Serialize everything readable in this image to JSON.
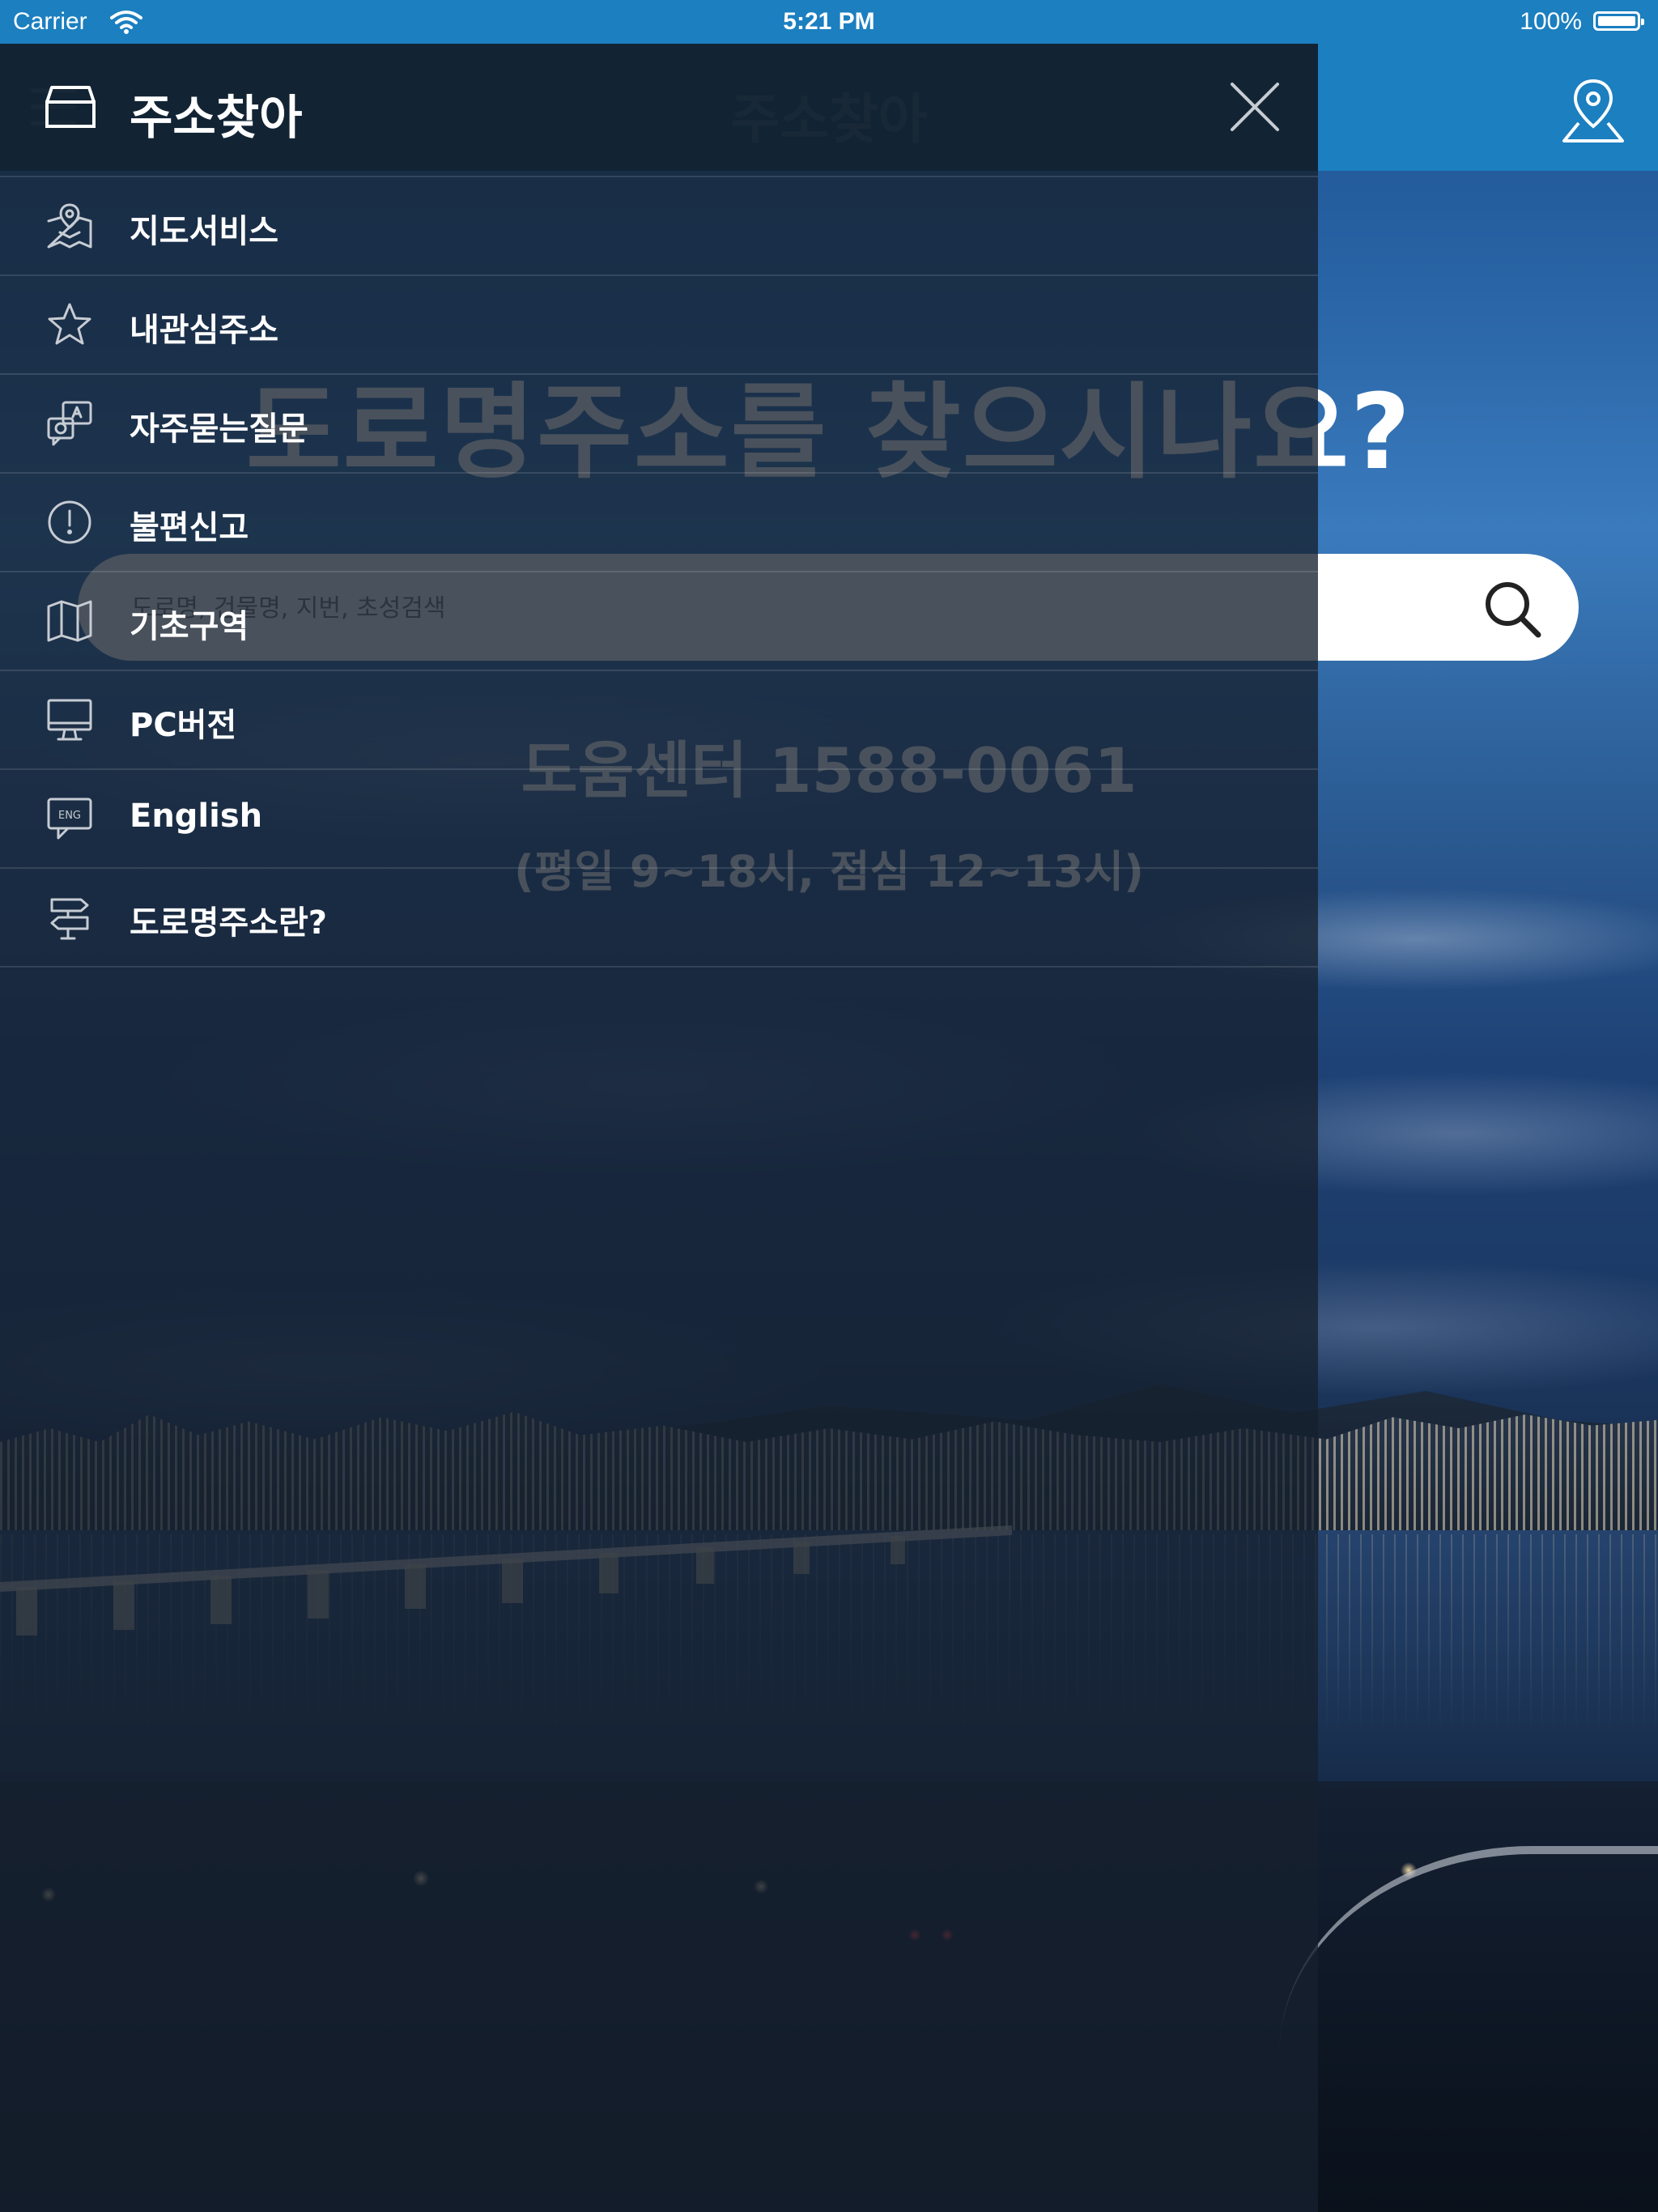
{
  "status_bar": {
    "carrier": "Carrier",
    "time": "5:21 PM",
    "battery": "100%"
  },
  "app_bar": {
    "title": "주소찾아"
  },
  "hero": {
    "question": "도로명주소를 찾으시나요?",
    "search_placeholder": "도로명, 건물명, 지번, 초성검색",
    "help_center": "도움센터 1588-0061",
    "hours": "(평일 9~18시, 점심 12~13시)"
  },
  "drawer": {
    "title": "주소찾아",
    "items": [
      {
        "label": "지도서비스",
        "icon": "map-pin-icon"
      },
      {
        "label": "내관심주소",
        "icon": "star-icon"
      },
      {
        "label": "자주묻는질문",
        "icon": "qa-chat-icon"
      },
      {
        "label": "불편신고",
        "icon": "exclamation-circle-icon"
      },
      {
        "label": "기초구역",
        "icon": "folded-map-icon"
      },
      {
        "label": "PC버전",
        "icon": "monitor-icon"
      },
      {
        "label": "English",
        "icon": "eng-chat-icon"
      },
      {
        "label": "도로명주소란?",
        "icon": "signpost-icon"
      }
    ]
  },
  "colors": {
    "primary": "#1b7fc0",
    "overlay": "#16202e",
    "icon_stroke": "#c7ccd3"
  }
}
